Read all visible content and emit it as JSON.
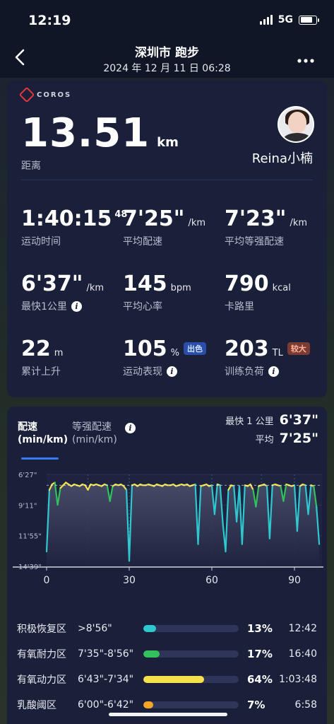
{
  "status": {
    "time": "12:19",
    "network": "5G"
  },
  "header": {
    "title": "深圳市 跑步",
    "subtitle": "2024 年 12 月 11 日 06:28"
  },
  "summary": {
    "brand": "COROS",
    "distance": {
      "value": "13.51",
      "unit": "km",
      "label": "距离"
    },
    "user_name": "Reina小楠",
    "stats": [
      {
        "value": "1:40:15",
        "sup": "48",
        "unit": "",
        "label": "运动时间"
      },
      {
        "value": "7'25\"",
        "unit": "/km",
        "label": "平均配速"
      },
      {
        "value": "7'23\"",
        "unit": "/km",
        "label": "平均等强配速"
      },
      {
        "value": "6'37\"",
        "unit": "/km",
        "label": "最快1公里"
      },
      {
        "value": "145",
        "unit": "bpm",
        "label": "平均心率"
      },
      {
        "value": "790",
        "unit": "kcal",
        "label": "卡路里"
      },
      {
        "value": "22",
        "unit": "m",
        "label": "累计上升"
      },
      {
        "value": "105",
        "unit": "%",
        "label": "运动表现",
        "badge": "出色"
      },
      {
        "value": "203",
        "unit": "TL",
        "label": "训练负荷",
        "badge": "较大"
      }
    ]
  },
  "pace_card": {
    "tabs": [
      {
        "label": "配速",
        "unit": "(min/km)"
      },
      {
        "label": "等强配速",
        "unit": "(min/km)"
      }
    ],
    "fastest_label": "最快 1 公里",
    "fastest_value": "6'37\"",
    "avg_label": "平均",
    "avg_value": "7'25\""
  },
  "chart_data": {
    "type": "line",
    "y_tick_labels": [
      "6'27\"",
      "9'11\"",
      "11'55\"",
      "14'39\""
    ],
    "y_ticks_sec": [
      387,
      551,
      715,
      879
    ],
    "x_tick_labels": [
      "0",
      "30",
      "60",
      "90"
    ],
    "x_ticks": [
      0,
      30,
      60,
      90
    ],
    "xlim": [
      0,
      100
    ],
    "ylim_sec": [
      387,
      879
    ],
    "y_inverted": true,
    "avg_pace_sec": 445,
    "colors": {
      "slow": "#2ec9d0",
      "mid": "#32c15b",
      "fast": "#f6e14a"
    },
    "x": [
      0,
      1,
      2,
      3,
      4,
      5,
      6,
      7,
      8,
      9,
      10,
      11,
      12,
      13,
      14,
      15,
      16,
      17,
      18,
      19,
      20,
      21,
      22,
      23,
      24,
      25,
      26,
      27,
      28,
      29,
      30,
      31,
      32,
      33,
      34,
      35,
      36,
      37,
      38,
      39,
      40,
      41,
      42,
      43,
      44,
      45,
      46,
      47,
      48,
      49,
      50,
      51,
      52,
      53,
      54,
      55,
      56,
      57,
      58,
      59,
      60,
      61,
      62,
      63,
      64,
      65,
      66,
      67,
      68,
      69,
      70,
      71,
      72,
      73,
      74,
      75,
      76,
      77,
      78,
      79,
      80,
      81,
      82,
      83,
      84,
      85,
      86,
      87,
      88,
      89,
      90,
      91,
      92,
      93,
      94,
      95,
      96,
      97,
      98,
      99
    ],
    "pace_sec": [
      800,
      470,
      440,
      430,
      550,
      460,
      445,
      430,
      440,
      450,
      440,
      445,
      450,
      440,
      445,
      470,
      440,
      445,
      440,
      445,
      450,
      440,
      445,
      530,
      450,
      440,
      445,
      440,
      450,
      470,
      850,
      445,
      440,
      450,
      440,
      445,
      445,
      440,
      445,
      450,
      440,
      445,
      450,
      440,
      445,
      445,
      440,
      450,
      445,
      440,
      445,
      440,
      450,
      445,
      440,
      760,
      450,
      445,
      440,
      450,
      445,
      600,
      440,
      445,
      650,
      800,
      470,
      445,
      450,
      640,
      450,
      760,
      445,
      450,
      440,
      470,
      560,
      450,
      445,
      440,
      450,
      730,
      445,
      440,
      445,
      450,
      530,
      440,
      445,
      450,
      445,
      690,
      450,
      440,
      445,
      600,
      445,
      450,
      560,
      760
    ]
  }
}
